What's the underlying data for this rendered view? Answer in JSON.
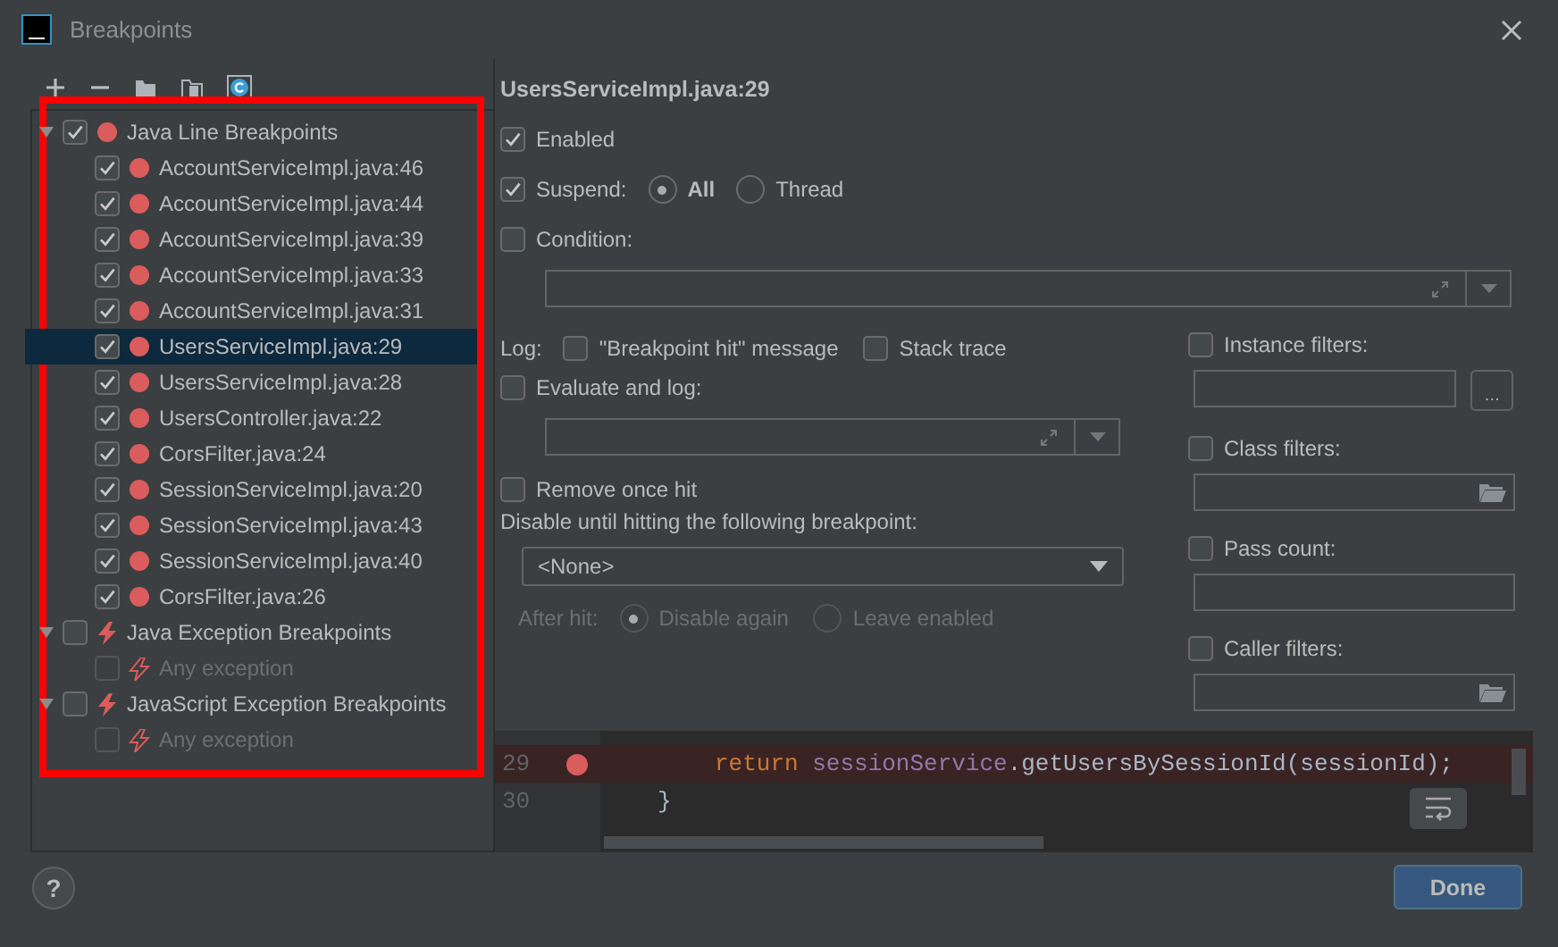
{
  "window": {
    "title": "Breakpoints"
  },
  "tree": [
    {
      "label": "Java Line Breakpoints",
      "kind": "line",
      "checked": true,
      "expanded": true,
      "selected": false,
      "disabled": false,
      "children": [
        {
          "label": "AccountServiceImpl.java:46",
          "kind": "line",
          "checked": true,
          "selected": false,
          "disabled": false
        },
        {
          "label": "AccountServiceImpl.java:44",
          "kind": "line",
          "checked": true,
          "selected": false,
          "disabled": false
        },
        {
          "label": "AccountServiceImpl.java:39",
          "kind": "line",
          "checked": true,
          "selected": false,
          "disabled": false
        },
        {
          "label": "AccountServiceImpl.java:33",
          "kind": "line",
          "checked": true,
          "selected": false,
          "disabled": false
        },
        {
          "label": "AccountServiceImpl.java:31",
          "kind": "line",
          "checked": true,
          "selected": false,
          "disabled": false
        },
        {
          "label": "UsersServiceImpl.java:29",
          "kind": "line",
          "checked": true,
          "selected": true,
          "disabled": false
        },
        {
          "label": "UsersServiceImpl.java:28",
          "kind": "line",
          "checked": true,
          "selected": false,
          "disabled": false
        },
        {
          "label": "UsersController.java:22",
          "kind": "line",
          "checked": true,
          "selected": false,
          "disabled": false
        },
        {
          "label": "CorsFilter.java:24",
          "kind": "line",
          "checked": true,
          "selected": false,
          "disabled": false
        },
        {
          "label": "SessionServiceImpl.java:20",
          "kind": "line",
          "checked": true,
          "selected": false,
          "disabled": false
        },
        {
          "label": "SessionServiceImpl.java:43",
          "kind": "line",
          "checked": true,
          "selected": false,
          "disabled": false
        },
        {
          "label": "SessionServiceImpl.java:40",
          "kind": "line",
          "checked": true,
          "selected": false,
          "disabled": false
        },
        {
          "label": "CorsFilter.java:26",
          "kind": "line",
          "checked": true,
          "selected": false,
          "disabled": false
        }
      ]
    },
    {
      "label": "Java Exception Breakpoints",
      "kind": "exception",
      "checked": false,
      "expanded": true,
      "selected": false,
      "disabled": false,
      "children": [
        {
          "label": "Any exception",
          "kind": "exception",
          "checked": false,
          "selected": false,
          "disabled": true
        }
      ]
    },
    {
      "label": "JavaScript Exception Breakpoints",
      "kind": "exception",
      "checked": false,
      "expanded": true,
      "selected": false,
      "disabled": false,
      "children": [
        {
          "label": "Any exception",
          "kind": "exception",
          "checked": false,
          "selected": false,
          "disabled": true
        }
      ]
    }
  ],
  "details": {
    "title": "UsersServiceImpl.java:29",
    "enabled": {
      "label": "Enabled",
      "checked": true
    },
    "suspend": {
      "label": "Suspend:",
      "checked": true,
      "options": [
        {
          "label": "All",
          "selected": true
        },
        {
          "label": "Thread",
          "selected": false
        }
      ]
    },
    "condition": {
      "label": "Condition:",
      "checked": false
    },
    "log": {
      "label": "Log:",
      "options": [
        {
          "label": "\"Breakpoint hit\" message",
          "checked": false
        },
        {
          "label": "Stack trace",
          "checked": false
        }
      ]
    },
    "evaluate": {
      "label": "Evaluate and log:",
      "checked": false
    },
    "remove_once_hit": {
      "label": "Remove once hit",
      "checked": false
    },
    "disable_until": {
      "label": "Disable until hitting the following breakpoint:",
      "value": "<None>"
    },
    "after_hit": {
      "label": "After hit:",
      "disabled": true,
      "options": [
        {
          "label": "Disable again",
          "selected": true
        },
        {
          "label": "Leave enabled",
          "selected": false
        }
      ]
    },
    "filters": [
      {
        "label": "Instance filters:",
        "checked": false,
        "kind": "more",
        "button": "…"
      },
      {
        "label": "Class filters:",
        "checked": false,
        "kind": "browse"
      },
      {
        "label": "Pass count:",
        "checked": false,
        "kind": "plain"
      },
      {
        "label": "Caller filters:",
        "checked": false,
        "kind": "browse"
      }
    ]
  },
  "code_preview": {
    "lines": [
      {
        "number": "29",
        "breakpoint": true,
        "tokens": [
          {
            "text": "return ",
            "kind": "keyword"
          },
          {
            "text": "sessionService",
            "kind": "field"
          },
          {
            "text": ".getUsersBySessionId(sessionId);",
            "kind": "plain"
          }
        ]
      },
      {
        "number": "30",
        "breakpoint": false,
        "tokens": [
          {
            "text": "}",
            "kind": "plain"
          }
        ]
      }
    ]
  },
  "buttons": {
    "help": "?",
    "done": "Done"
  }
}
